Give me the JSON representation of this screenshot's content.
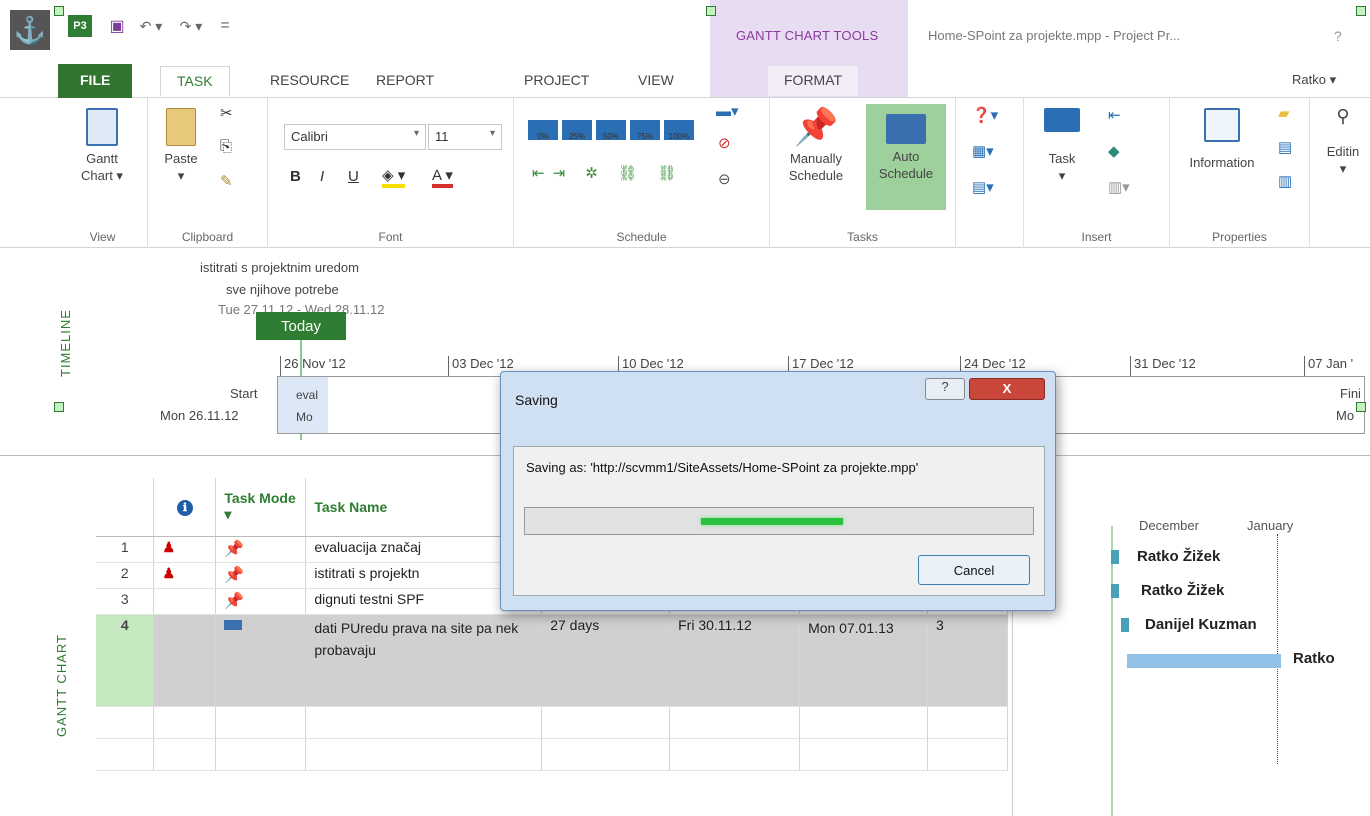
{
  "titlebar": {
    "project_icon": "P3",
    "undo": "↶ ▾",
    "redo": "↷ ▾",
    "customize": "=",
    "contextual_label": "GANTT CHART TOOLS",
    "document_title": "Home-SPoint za projekte.mpp - Project Pr...",
    "help": "?"
  },
  "tabs": {
    "file": "FILE",
    "task": "TASK",
    "resource": "RESOURCE",
    "report": "REPORT",
    "project": "PROJECT",
    "view": "VIEW",
    "format": "FORMAT",
    "user": "Ratko ▾"
  },
  "ribbon": {
    "view": {
      "gantt_label_line1": "Gantt",
      "gantt_label_line2": "Chart ▾",
      "group": "View"
    },
    "clipboard": {
      "paste": "Paste",
      "group": "Clipboard"
    },
    "font": {
      "family": "Calibri",
      "size": "11",
      "bold": "B",
      "italic": "I",
      "underline": "U",
      "group": "Font"
    },
    "schedule": {
      "pct": [
        "0%",
        "25%",
        "50%",
        "75%",
        "100%"
      ],
      "group": "Schedule"
    },
    "tasks": {
      "manual_line1": "Manually",
      "manual_line2": "Schedule",
      "auto_line1": "Auto",
      "auto_line2": "Schedule",
      "group": "Tasks"
    },
    "insert": {
      "task": "Task",
      "group": "Insert"
    },
    "properties": {
      "information": "Information",
      "group": "Properties"
    },
    "editing": {
      "label": "Editin"
    }
  },
  "timeline": {
    "label": "TIMELINE",
    "callout_line1": "istitrati s projektnim uredom",
    "callout_line2": "sve njihove potrebe",
    "callout_line3": "Tue 27.11.12 - Wed 28.11.12",
    "today": "Today",
    "ticks": [
      "26 Nov '12",
      "03 Dec '12",
      "10 Dec '12",
      "17 Dec '12",
      "24 Dec '12",
      "31 Dec '12",
      "07 Jan '"
    ],
    "start_label": "Start",
    "start_date": "Mon 26.11.12",
    "task_label_1": "eval",
    "task_label_2": "Mo",
    "finish_label": "Fini",
    "finish_date": "Mo"
  },
  "grid": {
    "side_label": "GANTT CHART",
    "headers": {
      "info": "ℹ",
      "mode": "Task Mode ▾",
      "name": "Task Name"
    },
    "rows": [
      {
        "id": "1",
        "name": "evaluacija značaj",
        "duration": "",
        "start": "",
        "finish": "",
        "pred": ""
      },
      {
        "id": "2",
        "name": "istitrati s projektn",
        "duration": "",
        "start": "",
        "finish": "",
        "pred": ""
      },
      {
        "id": "3",
        "name": "dignuti testni SPF",
        "duration": "",
        "start": "",
        "finish": "",
        "pred": ""
      },
      {
        "id": "4",
        "name": "dati PUredu prava na site pa nek probavaju",
        "duration": "27 days",
        "start": "Fri 30.11.12",
        "finish": "Mon 07.01.13",
        "pred": "3"
      }
    ]
  },
  "chart": {
    "month_prev": "ember",
    "month_dec": "December",
    "month_jan": "January",
    "resources": [
      "Ratko Žižek",
      "Ratko Žižek",
      "Danijel Kuzman",
      "Ratko"
    ]
  },
  "dialog": {
    "title": "Saving",
    "help": "?",
    "close": "X",
    "message": "Saving as: 'http://scvmm1/SiteAssets/Home-SPoint za projekte.mpp'",
    "progress": 0.28,
    "cancel": "Cancel"
  }
}
